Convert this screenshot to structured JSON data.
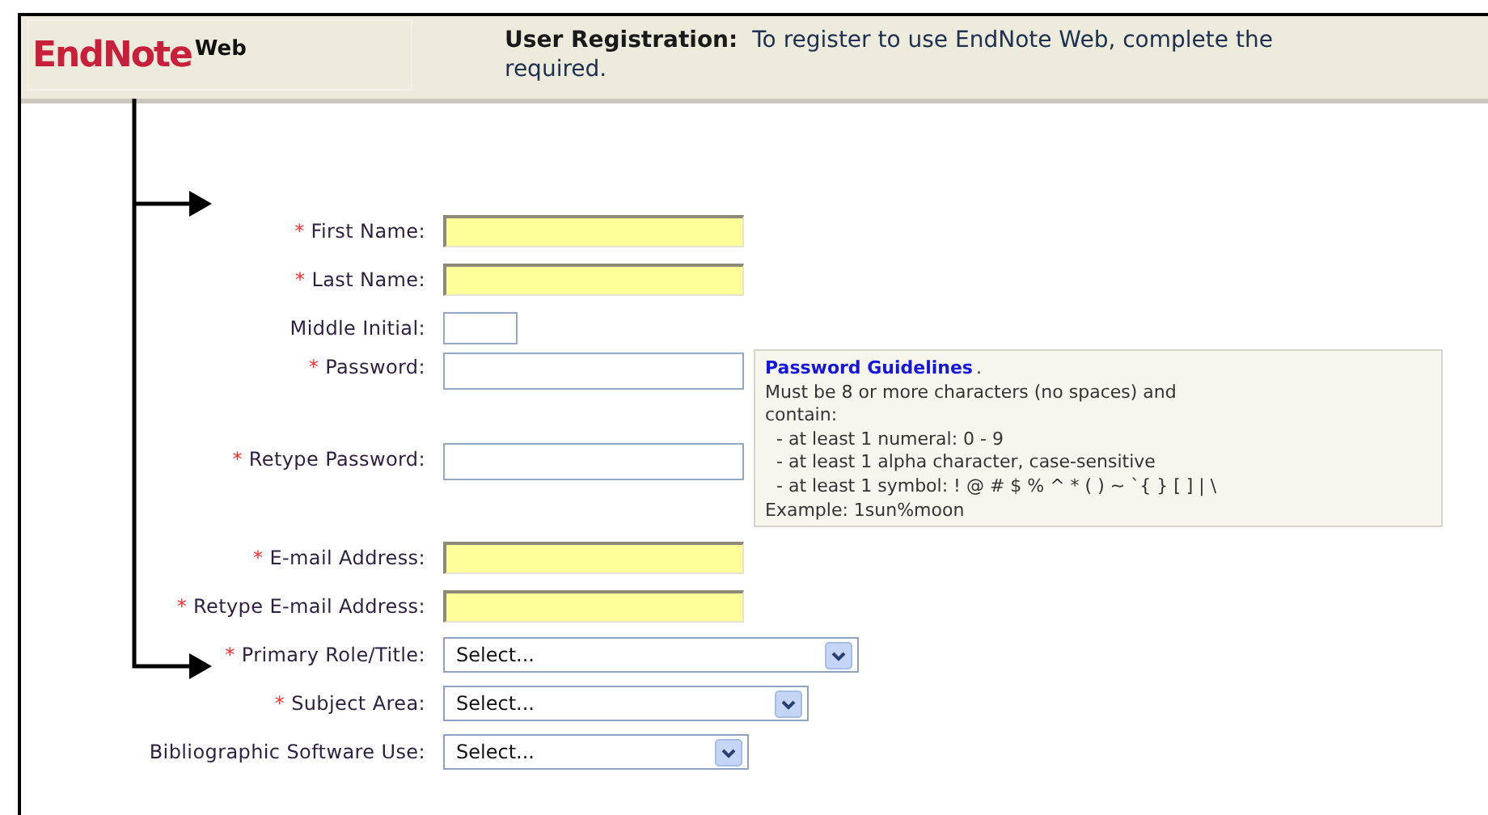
{
  "header": {
    "logo": {
      "name": "EndNote",
      "suffix": "Web"
    },
    "title": "User Registration:",
    "description": [
      "To register to use EndNote Web, complete the",
      "required."
    ]
  },
  "fields": [
    {
      "kind": "text",
      "label": "First Name:",
      "required_mark": "*",
      "highlighted": true
    },
    {
      "kind": "text",
      "label": "Last Name:",
      "required_mark": "*",
      "highlighted": true
    },
    {
      "kind": "text",
      "label": "Middle Initial:",
      "highlighted": false
    },
    {
      "kind": "password",
      "label": "Password:",
      "required_mark": "*",
      "highlighted": false
    },
    {
      "kind": "password",
      "label": "Retype Password:",
      "required_mark": "*",
      "highlighted": false
    },
    {
      "kind": "text",
      "label": "E-mail Address:",
      "required_mark": "*",
      "highlighted": true
    },
    {
      "kind": "text",
      "label": "Retype E-mail Address:",
      "required_mark": "*",
      "highlighted": true
    },
    {
      "kind": "select",
      "label": "Primary Role/Title:",
      "required_mark": "*",
      "value": "Select..."
    },
    {
      "kind": "select",
      "label": "Subject Area:",
      "required_mark": "*",
      "value": "Select..."
    },
    {
      "kind": "select",
      "label": "Bibliographic Software Use:",
      "value": "Select..."
    }
  ],
  "password_guidelines": {
    "title": "Password Guidelines",
    "title_suffix": ".",
    "lines": [
      "Must be 8 or more characters (no spaces) and",
      "contain:",
      "  - at least 1 numeral: 0 - 9",
      "  - at least 1 alpha character, case-sensitive",
      "  - at least 1 symbol: ! @ # $ % ^ * ( ) ~ `{ } [ ] | \\",
      "Example: 1sun%moon"
    ]
  }
}
